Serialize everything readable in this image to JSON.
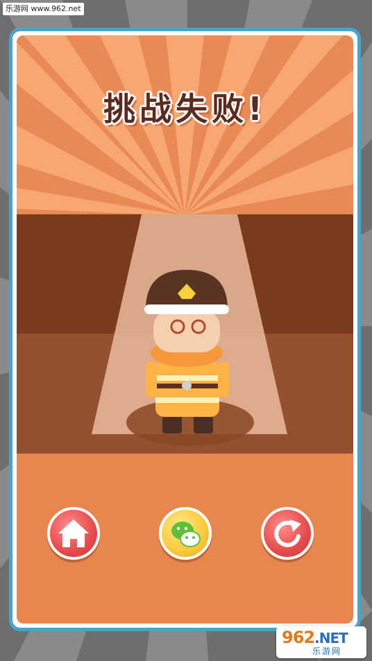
{
  "watermark_top": "乐游网 www.962.net",
  "title": "挑战失败!",
  "buttons": {
    "home": {
      "icon": "home-icon",
      "color": "#e54b4b"
    },
    "share": {
      "icon": "wechat-icon",
      "color": "#f9c93a"
    },
    "restart": {
      "icon": "restart-icon",
      "color": "#e54b4b"
    }
  },
  "character": {
    "icon": "firefighter-character",
    "state": "dizzy"
  },
  "watermark_logo": {
    "main": "962",
    "net": ".NET",
    "sub": "乐游网"
  },
  "colors": {
    "card_border": "#4aa3c9",
    "background_orange": "#e7864f",
    "title_color": "#5a2c1f",
    "floor_brown": "#7a3b1c"
  }
}
